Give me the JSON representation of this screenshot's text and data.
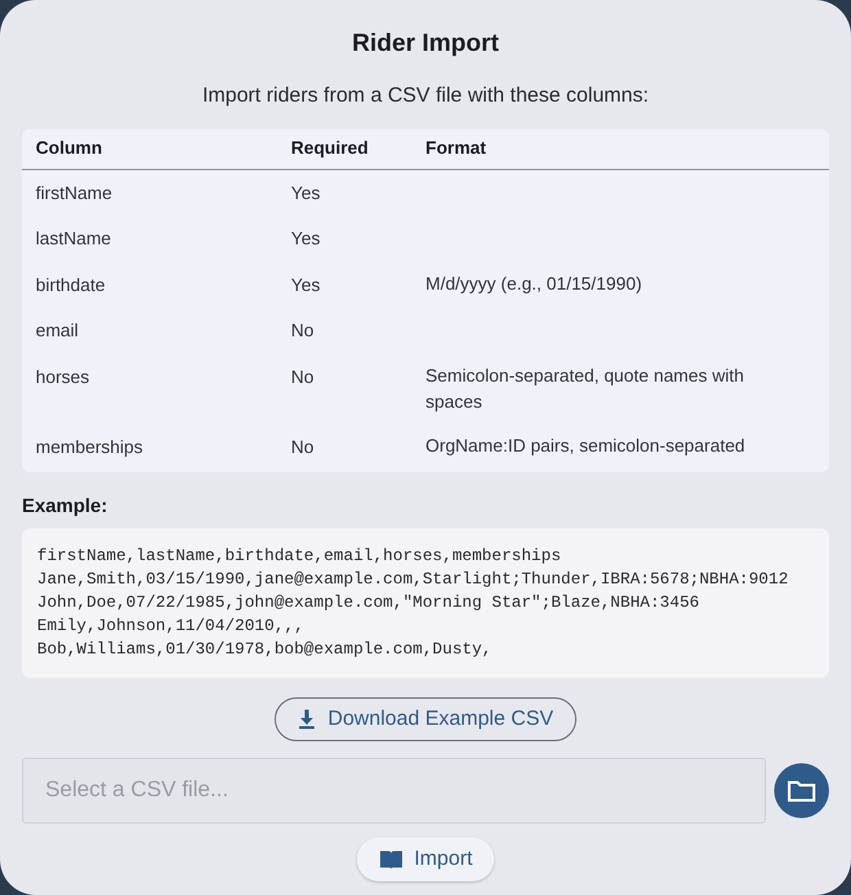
{
  "dialog": {
    "title": "Rider Import",
    "intro": "Import riders from a CSV file with these columns:"
  },
  "table": {
    "columns": [
      "Column",
      "Required",
      "Format"
    ],
    "rows": [
      [
        "firstName",
        "Yes",
        ""
      ],
      [
        "lastName",
        "Yes",
        ""
      ],
      [
        "birthdate",
        "Yes",
        "M/d/yyyy (e.g., 01/15/1990)"
      ],
      [
        "email",
        "No",
        ""
      ],
      [
        "horses",
        "No",
        "Semicolon-separated, quote names with spaces"
      ],
      [
        "memberships",
        "No",
        "OrgName:ID pairs, semicolon-separated"
      ]
    ]
  },
  "example": {
    "label": "Example:",
    "lines": [
      "firstName,lastName,birthdate,email,horses,memberships",
      "Jane,Smith,03/15/1990,jane@example.com,Starlight;Thunder,IBRA:5678;NBHA:9012",
      "John,Doe,07/22/1985,john@example.com,\"Morning Star\";Blaze,NBHA:3456",
      "Emily,Johnson,11/04/2010,,,",
      "Bob,Williams,01/30/1978,bob@example.com,Dusty,"
    ]
  },
  "download_button": "Download Example CSV",
  "file_field": {
    "placeholder": "Select a CSV file..."
  },
  "import_button": "Import"
}
